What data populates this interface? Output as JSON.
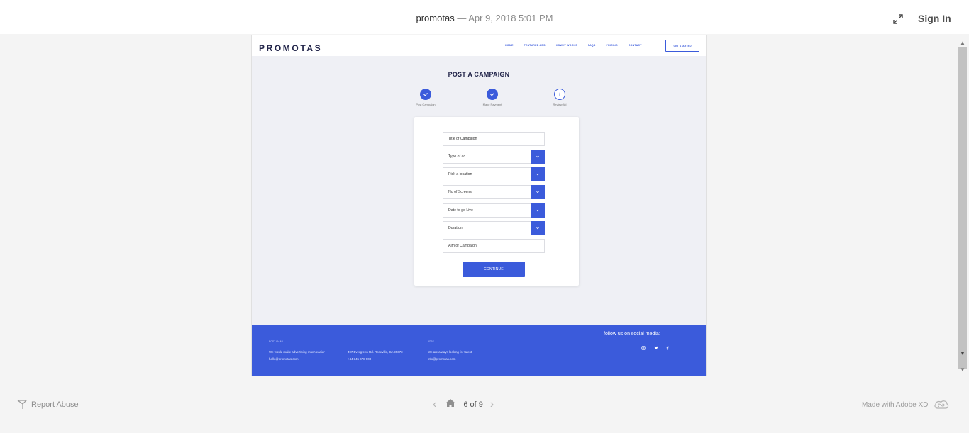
{
  "viewer": {
    "doc_name": "promotas",
    "separator": "—",
    "date": "Apr 9, 2018 5:01 PM",
    "sign_in": "Sign In",
    "report_abuse": "Report Abuse",
    "page_indicator": "6 of 9",
    "made_with": "Made with Adobe XD"
  },
  "site": {
    "logo": "PROMOTAS",
    "nav": [
      "HOME",
      "FEATURED ADS",
      "HOW IT WORKS",
      "FAQS",
      "PRICING",
      "CONTACT"
    ],
    "cta": "GET STARTED",
    "heading": "POST A CAMPAIGN",
    "steps": [
      {
        "label": "Post Campaign",
        "status": "done",
        "icon": "check-icon"
      },
      {
        "label": "Make Payment",
        "status": "done",
        "icon": "check-icon"
      },
      {
        "label": "Review Ad",
        "status": "todo",
        "icon": "info-icon"
      }
    ],
    "fields": [
      {
        "label": "Title of Campaign",
        "dropdown": false
      },
      {
        "label": "Type of ad",
        "dropdown": true
      },
      {
        "label": "Pick a location",
        "dropdown": true
      },
      {
        "label": "No of Screens",
        "dropdown": true
      },
      {
        "label": "Date to go Live",
        "dropdown": true
      },
      {
        "label": "Duration",
        "dropdown": true
      },
      {
        "label": "Aim of Campaign",
        "dropdown": false
      }
    ],
    "continue": "CONTINUE",
    "footer": {
      "col1_heading": "POST AN AD",
      "col1_line1": "We would make advertising much easier",
      "col1_line2": "hello@promotas.com",
      "col2_line1": "497 Evergreen Rd. Roseville, CA 95673",
      "col2_line2": "+44 345 678 903",
      "col3_heading": "JOBS",
      "col3_line1": "We are always looking for talent",
      "col3_line2": "info@promotas.com",
      "social_title": "follow us on social media:",
      "social_icons": [
        "instagram-icon",
        "twitter-icon",
        "facebook-icon"
      ]
    }
  },
  "colors": {
    "accent": "#3b5bdb",
    "artboard_bg": "#eff0f5",
    "logo": "#22254a"
  }
}
